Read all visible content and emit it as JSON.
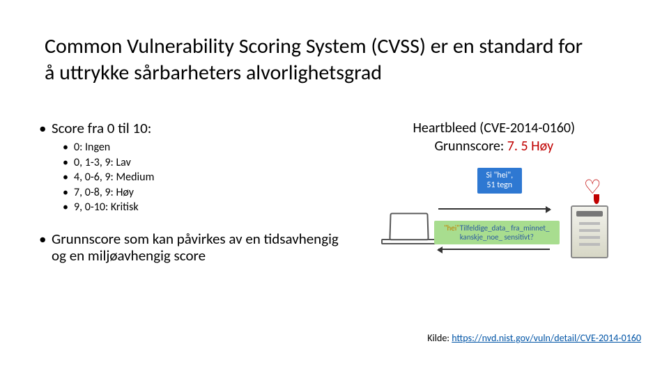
{
  "title": "Common Vulnerability Scoring System (CVSS) er en standard for å uttrykke sårbarheters alvorlighetsgrad",
  "left": {
    "score_heading": "Score fra 0 til 10:",
    "score_items": [
      "0: Ingen",
      "0, 1-3, 9: Lav",
      "4, 0-6, 9: Medium",
      "7, 0-8, 9: Høy",
      "9, 0-10: Kritisk"
    ],
    "grunnscore_text": "Grunnscore som kan påvirkes av en tidsavhengig og en miljøavhengig score"
  },
  "right": {
    "hb_line1": "Heartbleed (CVE-2014-0160)",
    "hb_line2_label": "Grunnscore:",
    "hb_line2_score": "7. 5 Høy",
    "bubble_blue": "Si \"hei\", 51 tegn",
    "bubble_green_hei": "\"hei\"",
    "bubble_green_leak": "Tilfeldige_data_ fra_minnet_ kanskje_noe_ sensitivt?"
  },
  "source": {
    "label": "Kilde: ",
    "link_text": "https://nvd.nist.gov/vuln/detail/CVE-2014-0160"
  }
}
